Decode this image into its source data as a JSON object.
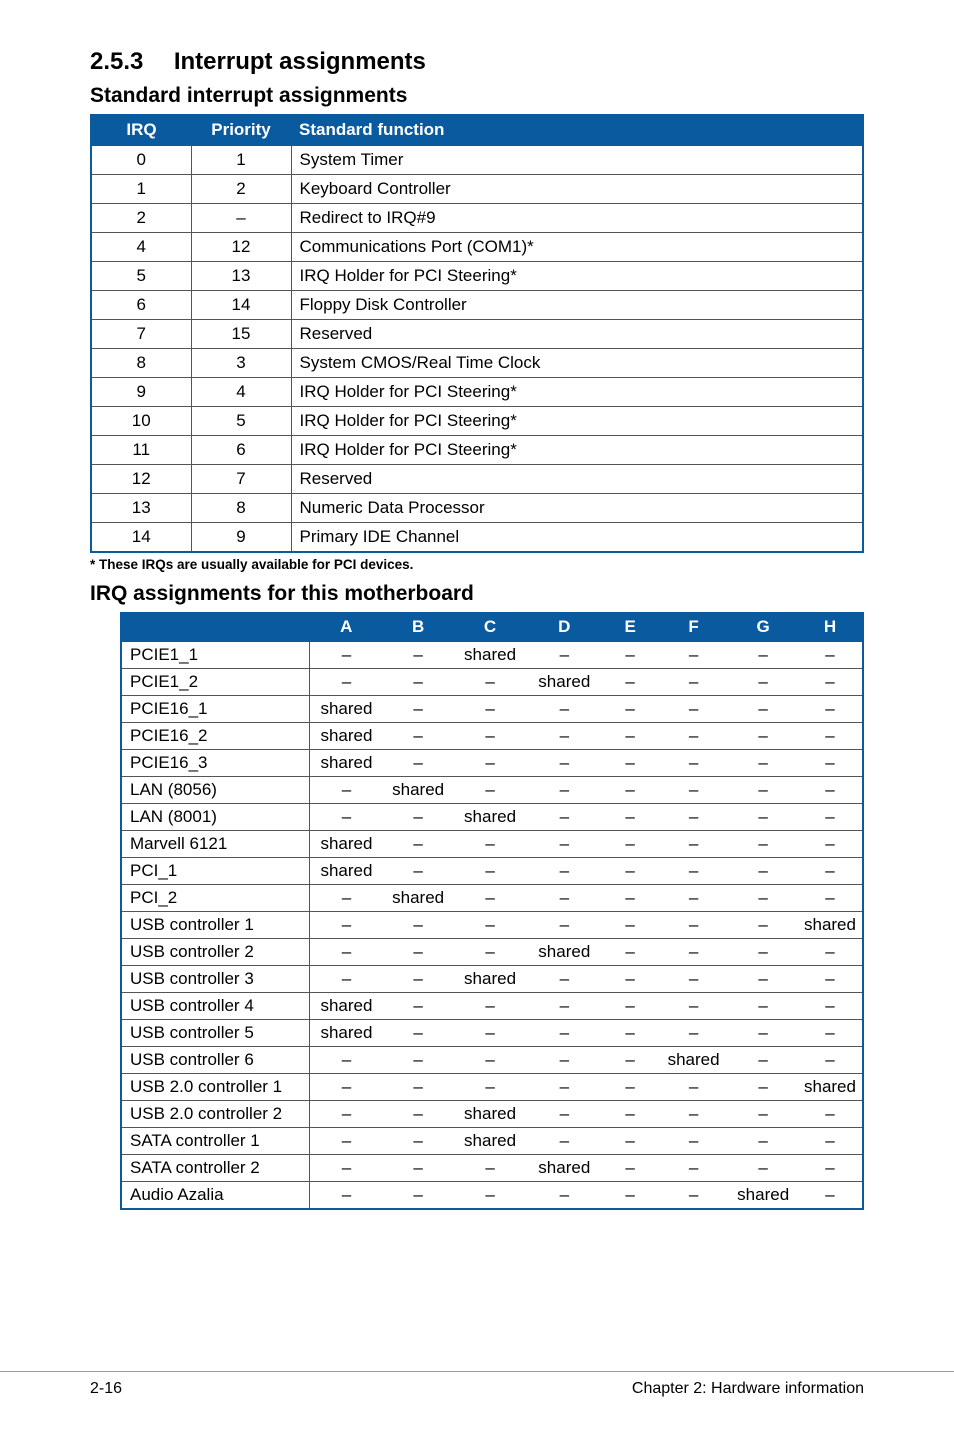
{
  "section": {
    "number": "2.5.3",
    "title": "Interrupt assignments"
  },
  "table1": {
    "heading": "Standard interrupt assignments",
    "headers": {
      "irq": "IRQ",
      "priority": "Priority",
      "fn": "Standard function"
    },
    "rows": [
      {
        "irq": "0",
        "pri": "1",
        "fn": "System Timer"
      },
      {
        "irq": "1",
        "pri": "2",
        "fn": "Keyboard Controller"
      },
      {
        "irq": "2",
        "pri": "–",
        "fn": "Redirect to IRQ#9"
      },
      {
        "irq": "4",
        "pri": "12",
        "fn": "Communications Port (COM1)*"
      },
      {
        "irq": "5",
        "pri": "13",
        "fn": "IRQ Holder for PCI Steering*"
      },
      {
        "irq": "6",
        "pri": "14",
        "fn": "Floppy Disk Controller"
      },
      {
        "irq": "7",
        "pri": "15",
        "fn": "Reserved"
      },
      {
        "irq": "8",
        "pri": "3",
        "fn": "System CMOS/Real Time Clock"
      },
      {
        "irq": "9",
        "pri": "4",
        "fn": "IRQ Holder for PCI Steering*"
      },
      {
        "irq": "10",
        "pri": "5",
        "fn": "IRQ Holder for PCI Steering*"
      },
      {
        "irq": "11",
        "pri": "6",
        "fn": "IRQ Holder for PCI Steering*"
      },
      {
        "irq": "12",
        "pri": "7",
        "fn": "Reserved"
      },
      {
        "irq": "13",
        "pri": "8",
        "fn": "Numeric Data Processor"
      },
      {
        "irq": "14",
        "pri": "9",
        "fn": "Primary IDE Channel"
      }
    ],
    "footnote": "* These IRQs are usually available for PCI devices."
  },
  "table2": {
    "heading": "IRQ assignments for this motherboard",
    "headers": [
      "A",
      "B",
      "C",
      "D",
      "E",
      "F",
      "G",
      "H"
    ],
    "rows": [
      {
        "label": "PCIE1_1",
        "cells": [
          "–",
          "–",
          "shared",
          "–",
          "–",
          "–",
          "–",
          "–"
        ]
      },
      {
        "label": "PCIE1_2",
        "cells": [
          "–",
          "–",
          "–",
          "shared",
          "–",
          "–",
          "–",
          "–"
        ]
      },
      {
        "label": "PCIE16_1",
        "cells": [
          "shared",
          "–",
          "–",
          "–",
          "–",
          "–",
          "–",
          "–"
        ]
      },
      {
        "label": "PCIE16_2",
        "cells": [
          "shared",
          "–",
          "–",
          "–",
          "–",
          "–",
          "–",
          "–"
        ]
      },
      {
        "label": "PCIE16_3",
        "cells": [
          "shared",
          "–",
          "–",
          "–",
          "–",
          "–",
          "–",
          "–"
        ]
      },
      {
        "label": "LAN (8056)",
        "cells": [
          "–",
          "shared",
          "–",
          "–",
          "–",
          "–",
          "–",
          "–"
        ]
      },
      {
        "label": "LAN (8001)",
        "cells": [
          "–",
          "–",
          "shared",
          "–",
          "–",
          "–",
          "–",
          "–"
        ]
      },
      {
        "label": "Marvell 6121",
        "cells": [
          "shared",
          "–",
          "–",
          "–",
          "–",
          "–",
          "–",
          "–"
        ]
      },
      {
        "label": "PCI_1",
        "cells": [
          "shared",
          "–",
          "–",
          "–",
          "–",
          "–",
          "–",
          "–"
        ]
      },
      {
        "label": "PCI_2",
        "cells": [
          "–",
          "shared",
          "–",
          "–",
          "–",
          "–",
          "–",
          "–"
        ]
      },
      {
        "label": "USB controller 1",
        "cells": [
          "–",
          "–",
          "–",
          "–",
          "–",
          "–",
          "–",
          "shared"
        ]
      },
      {
        "label": "USB controller 2",
        "cells": [
          "–",
          "–",
          "–",
          "shared",
          "–",
          "–",
          "–",
          "–"
        ]
      },
      {
        "label": "USB controller 3",
        "cells": [
          "–",
          "–",
          "shared",
          "–",
          "–",
          "–",
          "–",
          "–"
        ]
      },
      {
        "label": "USB controller 4",
        "cells": [
          "shared",
          "–",
          "–",
          "–",
          "–",
          "–",
          "–",
          "–"
        ]
      },
      {
        "label": "USB controller 5",
        "cells": [
          "shared",
          "–",
          "–",
          "–",
          "–",
          "–",
          "–",
          "–"
        ]
      },
      {
        "label": "USB controller 6",
        "cells": [
          "–",
          "–",
          "–",
          "–",
          "–",
          "shared",
          "–",
          "–"
        ]
      },
      {
        "label": "USB 2.0 controller 1",
        "cells": [
          "–",
          "–",
          "–",
          "–",
          "–",
          "–",
          "–",
          "shared"
        ]
      },
      {
        "label": "USB 2.0 controller 2",
        "cells": [
          "–",
          "–",
          "shared",
          "–",
          "–",
          "–",
          "–",
          "–"
        ]
      },
      {
        "label": "SATA controller 1",
        "cells": [
          "–",
          "–",
          "shared",
          "–",
          "–",
          "–",
          "–",
          "–"
        ]
      },
      {
        "label": "SATA controller 2",
        "cells": [
          "–",
          "–",
          "–",
          "shared",
          "–",
          "–",
          "–",
          "–"
        ]
      },
      {
        "label": "Audio Azalia",
        "cells": [
          "–",
          "–",
          "–",
          "–",
          "–",
          "–",
          "shared",
          "–"
        ]
      }
    ]
  },
  "footer": {
    "left": "2-16",
    "right": "Chapter 2: Hardware information"
  }
}
